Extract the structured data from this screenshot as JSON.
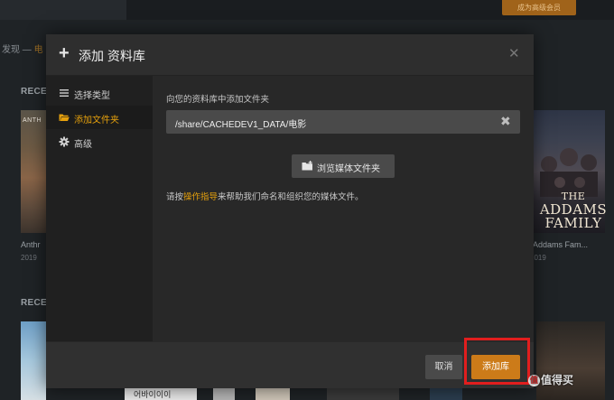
{
  "background": {
    "premium_button": "成为高级会员",
    "breadcrumb_main": "发现",
    "breadcrumb_sep": " — ",
    "breadcrumb_accent": "电",
    "section1_title": "RECE",
    "section2_title": "RECE",
    "poster_left_caption": "Anthr",
    "poster_left_year": "2019",
    "poster_left_top_text": "ANTH",
    "poster_right_caption": "he Addams Fam...",
    "poster_right_year": "2019",
    "addams_logo_small": "THE",
    "addams_logo_big": "ADDAMS FAMILY",
    "korean_text": "어바이이이"
  },
  "modal": {
    "title_icon": "plus-icon",
    "title": "添加 资料库",
    "close_icon": "close-icon",
    "sidebar": [
      {
        "label": "选择类型",
        "icon": "list-icon",
        "active": false
      },
      {
        "label": "添加文件夹",
        "icon": "folder-open-icon",
        "active": true
      },
      {
        "label": "高级",
        "icon": "gear-icon",
        "active": false
      }
    ],
    "content_label": "向您的资料库中添加文件夹",
    "path_value": "/share/CACHEDEV1_DATA/电影",
    "clear_icon": "clear-icon",
    "browse_icon": "folder-plus-icon",
    "browse_label": "浏览媒体文件夹",
    "hint_prefix": "请按",
    "hint_link": "操作指导",
    "hint_suffix": "来帮助我们命名和组织您的媒体文件。",
    "cancel_label": "取消",
    "add_label": "添加库"
  },
  "watermark": {
    "text": "值得买",
    "icon_char": "值"
  },
  "colors": {
    "accent": "#e5a00d",
    "add_button": "#cc7b19",
    "highlight_box": "#e11e1e"
  }
}
